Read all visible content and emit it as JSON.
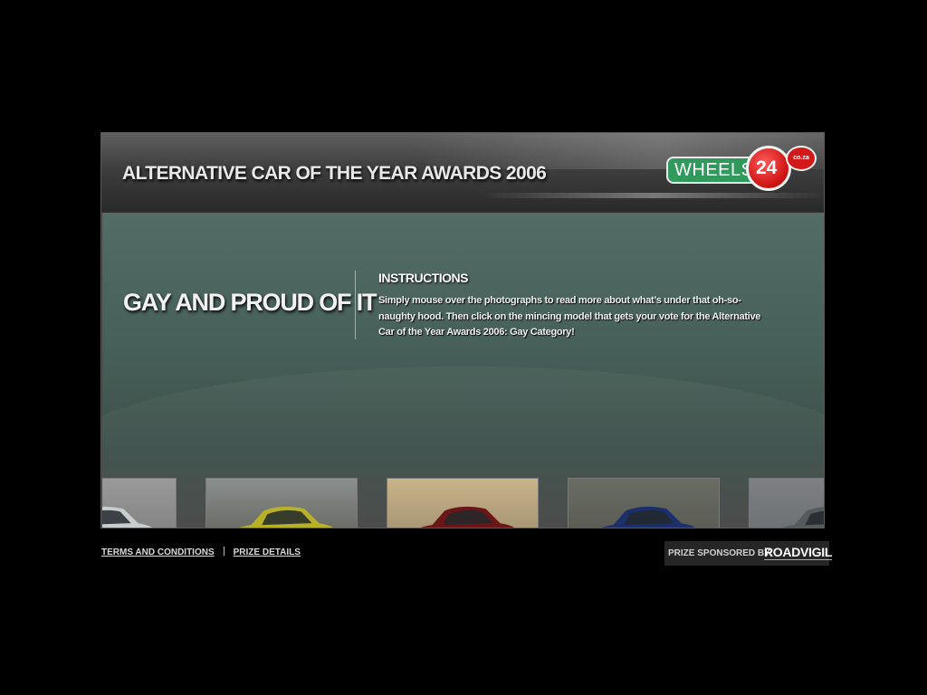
{
  "header": {
    "title": "ALTERNATIVE CAR OF THE YEAR AWARDS 2006",
    "logo": {
      "word": "WHEELS",
      "number": "24",
      "suffix": "co.za"
    }
  },
  "category": {
    "title": "GAY AND PROUD OF IT"
  },
  "instructions": {
    "heading": "INSTRUCTIONS",
    "text": "Simply mouse over the photographs to read more about what’s under that oh-so-naughty hood. Then click on the mincing model that gets your vote for the Alternative Car of the Year Awards 2006: Gay Category!"
  },
  "cars": [
    {
      "icon": "silver-coupe-photo",
      "body": "#c9cccd",
      "scene": [
        "#9a9a9a",
        "#6f6f6f"
      ]
    },
    {
      "icon": "yellow-hatchback-photo",
      "body": "#b7b02a",
      "scene": [
        "#8a8f8f",
        "#4e4a3e"
      ]
    },
    {
      "icon": "red-sedan-photo",
      "body": "#6b1616",
      "scene": [
        "#c8b48a",
        "#8a7a62"
      ]
    },
    {
      "icon": "blue-sports-car-photo",
      "body": "#1c2f6a",
      "scene": [
        "#6a6d64",
        "#4c4d47"
      ]
    },
    {
      "icon": "grey-hatchback-photo",
      "body": "#545a5e",
      "scene": [
        "#7d8184",
        "#5d6164"
      ]
    }
  ],
  "footer": {
    "terms_label": "TERMS AND CONDITIONS",
    "prize_label": "PRIZE DETAILS"
  },
  "sponsor": {
    "label": "PRIZE SPONSORED BY",
    "brand": "ROADVIGIL"
  }
}
